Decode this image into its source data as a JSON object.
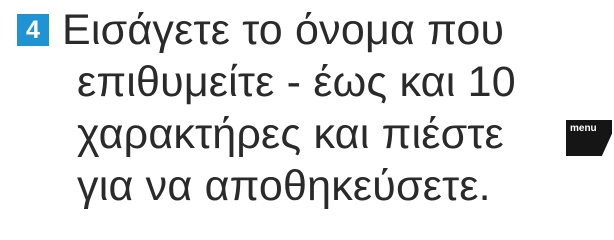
{
  "step": {
    "number": "4",
    "badge_color": "#1f93d3",
    "lines": [
      "Εισάγετε το όνομα που",
      "επιθυμείτε - έως και 10",
      "χαρακτήρες και πιέστε",
      "για να αποθηκεύσετε."
    ],
    "menu_key": {
      "label": "menu",
      "icon": "menu-key-icon"
    }
  }
}
